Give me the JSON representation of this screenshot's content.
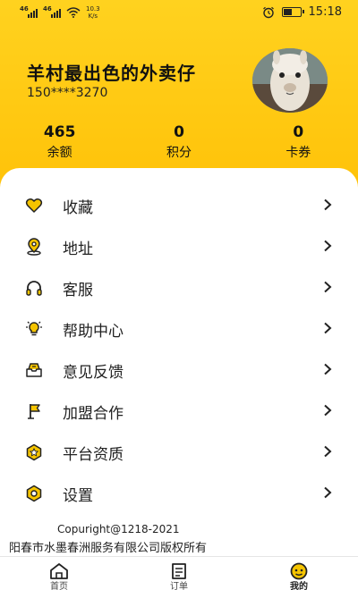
{
  "status_bar": {
    "net_speed": "10.3",
    "net_unit": "K/s",
    "time": "15:18",
    "battery_level": 0.55
  },
  "profile": {
    "username": "羊村最出色的外卖仔",
    "phone": "150****3270"
  },
  "stats": [
    {
      "value": "465",
      "label": "余额"
    },
    {
      "value": "0",
      "label": "积分"
    },
    {
      "value": "0",
      "label": "卡券"
    }
  ],
  "menu": [
    {
      "label": "收藏",
      "icon": "heart-icon"
    },
    {
      "label": "地址",
      "icon": "location-pin-icon"
    },
    {
      "label": "客服",
      "icon": "headphones-icon"
    },
    {
      "label": "帮助中心",
      "icon": "lightbulb-icon"
    },
    {
      "label": "意见反馈",
      "icon": "feedback-tray-icon"
    },
    {
      "label": "加盟合作",
      "icon": "flag-icon"
    },
    {
      "label": "平台资质",
      "icon": "badge-icon"
    },
    {
      "label": "设置",
      "icon": "settings-icon"
    }
  ],
  "footer": {
    "copyright": "Copuright@1218-2021",
    "company": "阳春市水墨春洲服务有限公司版权所有"
  },
  "tabs": [
    {
      "label": "首页",
      "icon": "home-icon"
    },
    {
      "label": "订单",
      "icon": "order-icon"
    },
    {
      "label": "我的",
      "icon": "profile-face-icon",
      "active": true
    }
  ],
  "colors": {
    "brand": "#FFC107",
    "brand_light": "#FFD21F",
    "icon_accent": "#F5C400"
  }
}
